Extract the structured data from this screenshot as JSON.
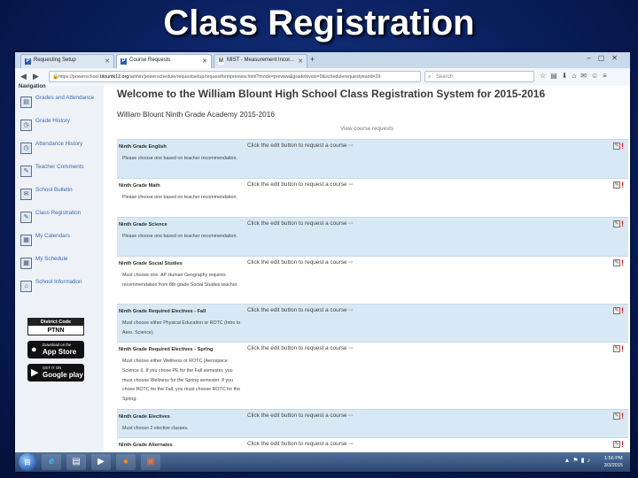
{
  "slide": {
    "title": "Class Registration"
  },
  "browser": {
    "tabs": [
      {
        "favicon": "P",
        "label": "Requesting Setup"
      },
      {
        "favicon": "P",
        "label": "Course Requests"
      },
      {
        "favicon": "M",
        "label": "MIST - Measurement Incor..."
      }
    ],
    "new_tab": "+",
    "url_prefix": "https://powerschool.",
    "url_host": "blountk12.org",
    "url_rest": "/admin/powerschedule/requestsetup/requestformpreview.html?mode=preview&gradelevels=9&schedulerequestyearid=29",
    "search_placeholder": "Search"
  },
  "sidebar": {
    "heading": "Navigation",
    "items": [
      {
        "icon": "grades-icon",
        "glyph": "▤",
        "label": "Grades and Attendance"
      },
      {
        "icon": "history-icon",
        "glyph": "◷",
        "label": "Grade History"
      },
      {
        "icon": "attendance-icon",
        "glyph": "◷",
        "label": "Attendance History"
      },
      {
        "icon": "comments-icon",
        "glyph": "✎",
        "label": "Teacher Comments"
      },
      {
        "icon": "bulletin-icon",
        "glyph": "✉",
        "label": "School Bulletin"
      },
      {
        "icon": "registration-icon",
        "glyph": "✎",
        "label": "Class Registration"
      },
      {
        "icon": "calendar-icon",
        "glyph": "▦",
        "label": "My Calendars"
      },
      {
        "icon": "schedule-icon",
        "glyph": "▦",
        "label": "My Schedule"
      },
      {
        "icon": "school-icon",
        "glyph": "⌂",
        "label": "School Information"
      }
    ],
    "district_code_label": "District Code",
    "district_code": "PTNN",
    "app_store": {
      "small": "Download on the",
      "big": "App Store"
    },
    "google_play": {
      "small": "GET IT ON",
      "big": "Google play"
    }
  },
  "main": {
    "welcome": "Welcome to the William Blount High School Class Registration System for 2015-2016",
    "academy": "William Blount Ninth Grade Academy 2015-2016",
    "view_link": "View course requests",
    "request_text": "Click the edit button to request a course",
    "rows": [
      {
        "title": "Ninth Grade English",
        "note": "Please choose one based on teacher recommendation."
      },
      {
        "title": "Ninth Grade Math",
        "note": "Please choose one based on teacher recommendation."
      },
      {
        "title": "Ninth Grade Science",
        "note": "Please choose one based on teacher recommendation."
      },
      {
        "title": "Ninth Grade Social Studies",
        "note": "Must choose one. AP Human Geography requires recommendation from 8th grade Social Studies teacher."
      },
      {
        "title": "Ninth Grade Required Electives - Fall",
        "note": "Must choose either Physical Education or ROTC (Intro to Aero. Science)"
      },
      {
        "title": "Ninth Grade Required Electives - Spring",
        "note": "Must choose either Wellness or ROTC (Aerospace Science I). If you chose PE for the Fall semester, you must choose Wellness for the Spring semester. If you chose ROTC for the Fall, you must choose ROTC for the Spring."
      },
      {
        "title": "Ninth Grade Electives",
        "note": "Must choose 2 elective classes."
      },
      {
        "title": "Ninth Grade Alternates",
        "note": ""
      }
    ]
  },
  "taskbar": {
    "time": "1:56 PM",
    "date": "3/3/2015"
  },
  "colors": {
    "row_shaded": "#d8e8f4",
    "link_blue": "#3a68b0",
    "alert_red": "#d11111"
  }
}
